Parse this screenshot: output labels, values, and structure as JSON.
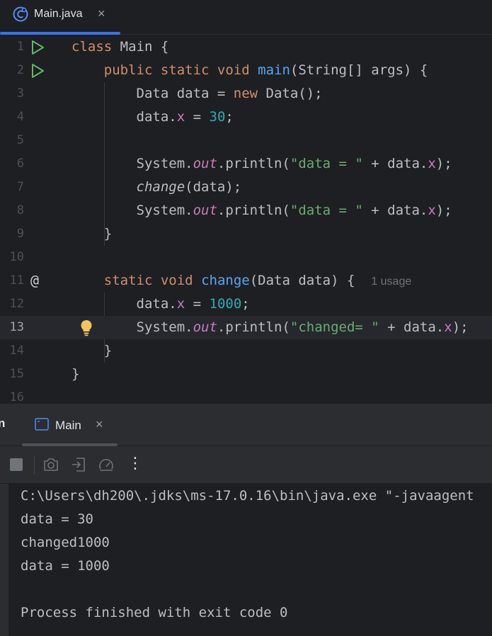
{
  "editor_tab": {
    "label": "Main.java",
    "close": "×"
  },
  "code_lines": [
    {
      "num": "1"
    },
    {
      "num": "2"
    },
    {
      "num": "3"
    },
    {
      "num": "4"
    },
    {
      "num": "5"
    },
    {
      "num": "6"
    },
    {
      "num": "7"
    },
    {
      "num": "8"
    },
    {
      "num": "9"
    },
    {
      "num": "10"
    },
    {
      "num": "11",
      "hint": "1 usage",
      "gutter": "@"
    },
    {
      "num": "12"
    },
    {
      "num": "13"
    },
    {
      "num": "14"
    },
    {
      "num": "15"
    },
    {
      "num": "16"
    }
  ],
  "run_panel": {
    "title": "n",
    "tab_label": "Main",
    "close": "×",
    "more": "⋮"
  },
  "console": {
    "lines": [
      "C:\\Users\\dh200\\.jdks\\ms-17.0.16\\bin\\java.exe \"-javaagent",
      "data = 30",
      "changed1000",
      "data = 1000",
      "",
      "Process finished with exit code 0"
    ]
  },
  "colors": {
    "background": "#1e1f22",
    "keyword": "#cf8e6d",
    "function": "#56a8f5",
    "number": "#2aacb8",
    "string": "#6aab73",
    "field": "#c77dbb",
    "accent": "#3574f0",
    "run_icon": "#5fb865",
    "bulb": "#f2c55c"
  },
  "icons": {
    "file": "java-class-icon",
    "run": "run-gutter-icon",
    "bulb": "intention-bulb-icon",
    "terminal": "terminal-icon",
    "stop": "stop-icon",
    "camera": "camera-icon",
    "exit": "exit-icon",
    "profiler": "profiler-icon"
  }
}
